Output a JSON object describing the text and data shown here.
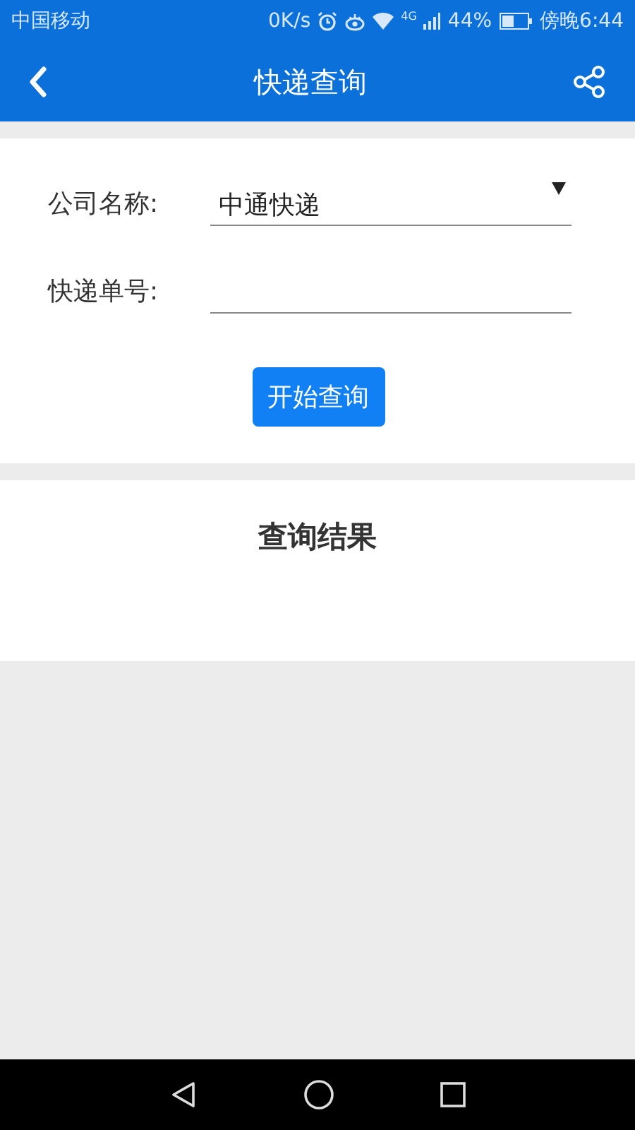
{
  "status_bar": {
    "carrier": "中国移动",
    "speed": "0K/s",
    "network": "4G",
    "battery": {
      "reading": "44%"
    },
    "time": "傍晚6:44"
  },
  "header": {
    "title": "快递查询"
  },
  "form": {
    "fields": [
      {
        "kind": "select",
        "label": "公司名称:",
        "value": "中通快递"
      },
      {
        "kind": "input",
        "label": "快递单号:"
      }
    ],
    "button": "开始查询"
  },
  "result": {
    "title": "查询结果"
  }
}
